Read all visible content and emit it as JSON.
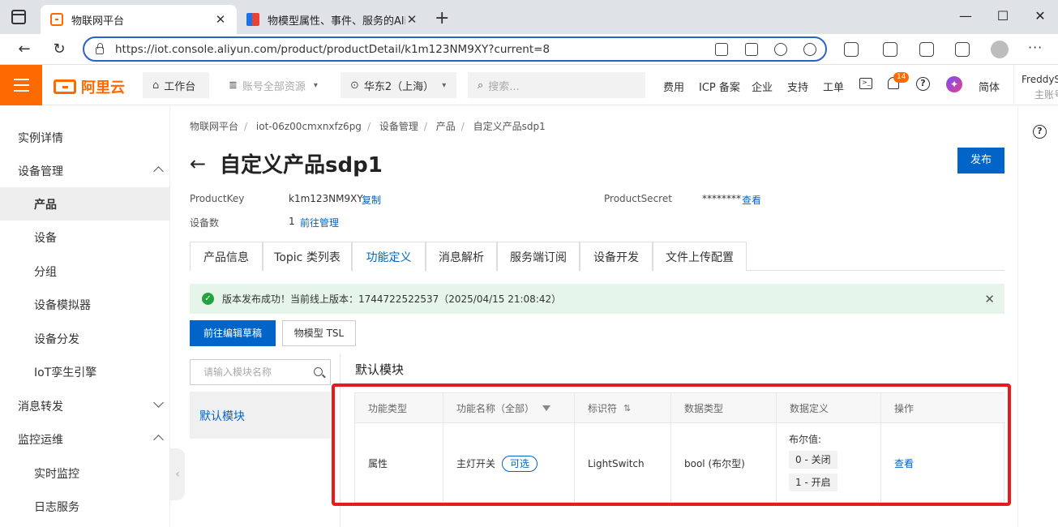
{
  "browser": {
    "tabs": [
      {
        "title": "物联网平台",
        "active": true
      },
      {
        "title": "物模型属性、事件、服务的Alink",
        "active": false
      }
    ],
    "url": "https://iot.console.aliyun.com/product/productDetail/k1m123NM9XY?current=8"
  },
  "topbar": {
    "logo": "阿里云",
    "workbench": "工作台",
    "resources": "账号全部资源",
    "region": "华东2（上海）",
    "search_placeholder": "搜索...",
    "links": [
      "费用",
      "ICP 备案",
      "企业",
      "支持",
      "工单"
    ],
    "notification_count": "14",
    "language": "简体",
    "user_name": "FreddySs",
    "user_role": "主账号"
  },
  "sidebar": {
    "items": [
      {
        "label": "实例详情"
      },
      {
        "label": "设备管理"
      },
      {
        "label": "产品"
      },
      {
        "label": "设备"
      },
      {
        "label": "分组"
      },
      {
        "label": "设备模拟器"
      },
      {
        "label": "设备分发"
      },
      {
        "label": "IoT孪生引擎"
      },
      {
        "label": "消息转发"
      },
      {
        "label": "监控运维"
      },
      {
        "label": "实时监控"
      },
      {
        "label": "日志服务"
      }
    ]
  },
  "breadcrumb": [
    "物联网平台",
    "iot-06z00cmxnxfz6pg",
    "设备管理",
    "产品",
    "自定义产品sdp1"
  ],
  "page": {
    "title": "自定义产品sdp1",
    "publish": "发布",
    "product_key_label": "ProductKey",
    "product_key": "k1m123NM9XY",
    "copy": "复制",
    "product_secret_label": "ProductSecret",
    "product_secret": "********",
    "view_secret": "查看",
    "device_count_label": "设备数",
    "device_count": "1",
    "manage_link": "前往管理"
  },
  "tabs": [
    "产品信息",
    "Topic 类列表",
    "功能定义",
    "消息解析",
    "服务端订阅",
    "设备开发",
    "文件上传配置"
  ],
  "alert": "版本发布成功！当前线上版本：1744722522537（2025/04/15 21:08:42）",
  "buttons": {
    "edit_draft": "前往编辑草稿",
    "tsl": "物模型 TSL"
  },
  "modules": {
    "search_placeholder": "请输入模块名称",
    "items": [
      "默认模块"
    ],
    "section_title": "默认模块"
  },
  "table": {
    "headers": [
      "功能类型",
      "功能名称（全部）",
      "标识符",
      "数据类型",
      "数据定义",
      "操作"
    ],
    "row": {
      "type": "属性",
      "name": "主灯开关",
      "tag": "可选",
      "identifier": "LightSwitch",
      "data_type": "bool (布尔型)",
      "def_label": "布尔值:",
      "def_values": [
        "0 - 关闭",
        "1 - 开启"
      ],
      "action": "查看"
    }
  }
}
